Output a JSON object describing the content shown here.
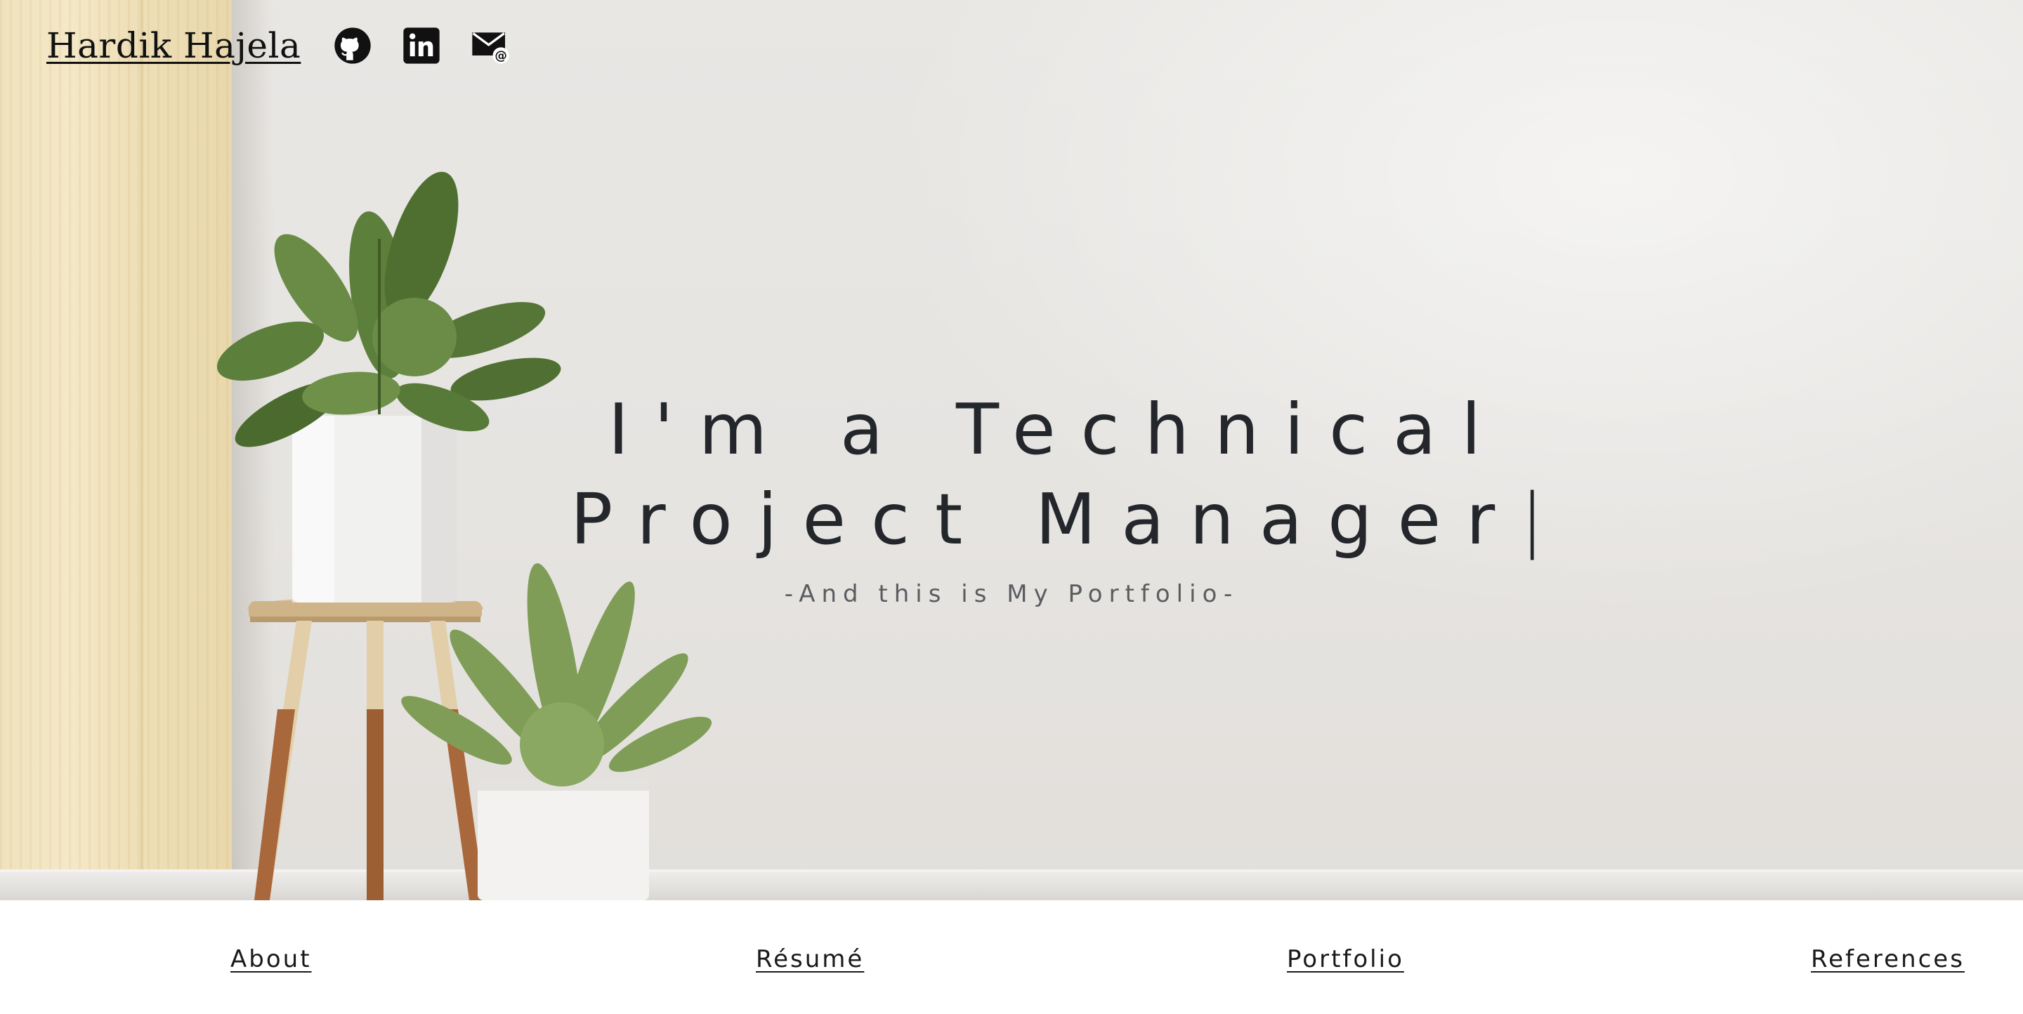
{
  "header": {
    "brand_name": "Hardik Hajela",
    "social_links": [
      {
        "icon": "github-icon",
        "label": "GitHub"
      },
      {
        "icon": "linkedin-icon",
        "label": "LinkedIn"
      },
      {
        "icon": "email-icon",
        "label": "Email"
      }
    ]
  },
  "hero": {
    "headline_line1": "I'm a Technical",
    "headline_line2": "Project Manager",
    "typing_cursor": "|",
    "subtitle": "-And this is My Portfolio-"
  },
  "nav": {
    "items": [
      {
        "label": "About"
      },
      {
        "label": "Résumé"
      },
      {
        "label": "Portfolio"
      },
      {
        "label": "References"
      }
    ]
  },
  "colors": {
    "text_dark": "#23272b",
    "subtitle": "#5a5d60",
    "wall": "#e7e5e2",
    "wood": "#f0e2bb",
    "leaf": "#5a7a3a",
    "icon": "#111111"
  }
}
